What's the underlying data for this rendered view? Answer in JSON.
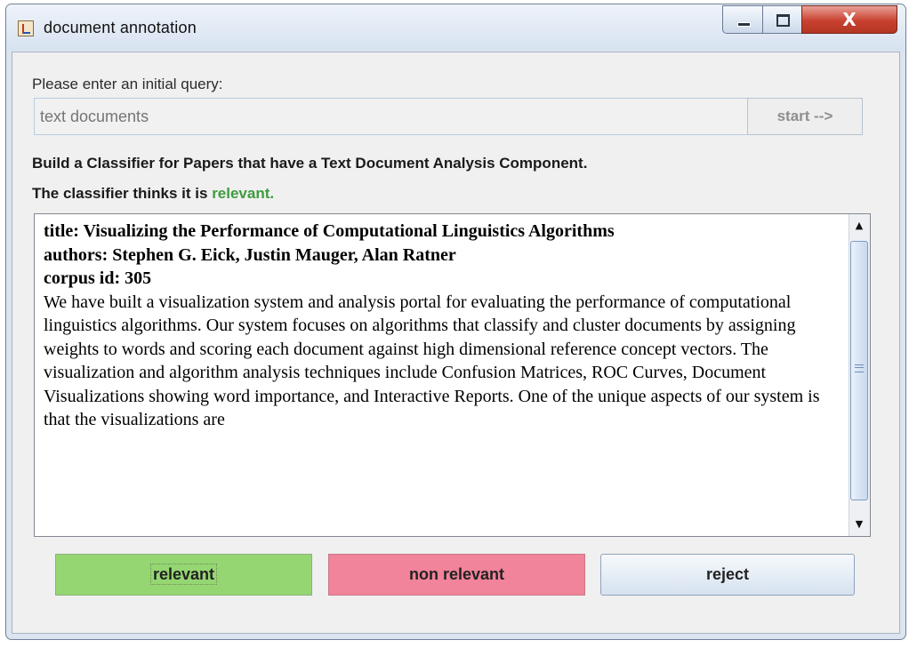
{
  "window": {
    "title": "document annotation",
    "close_glyph": "X"
  },
  "query": {
    "prompt_label": "Please enter an initial query:",
    "placeholder": "text documents",
    "start_label": "start -->"
  },
  "task": {
    "heading": "Build a Classifier for Papers that have a Text Document Analysis Component.",
    "status_prefix": "The classifier thinks it is ",
    "status_value": "relevant."
  },
  "document": {
    "title_line": "title: Visualizing the Performance of Computational Linguistics Algorithms",
    "authors_line": "authors: Stephen G. Eick, Justin Mauger, Alan Ratner",
    "corpus_line": "corpus id: 305",
    "abstract": "We have built a visualization system and analysis portal for evaluating the performance of computational linguistics algorithms. Our system focuses on algorithms that classify and cluster documents by assigning weights to words and scoring each document against high dimensional reference concept vectors. The visualization and algorithm analysis techniques include Confusion Matrices, ROC Curves, Document Visualizations showing word importance, and Interactive Reports. One of the unique aspects of our system is that the visualizations are"
  },
  "actions": {
    "relevant_label": "relevant",
    "non_relevant_label": "non relevant",
    "reject_label": "reject"
  },
  "colors": {
    "relevant_green": "#95d672",
    "non_relevant_pink": "#f1839a",
    "status_green": "#3d9b3d"
  }
}
